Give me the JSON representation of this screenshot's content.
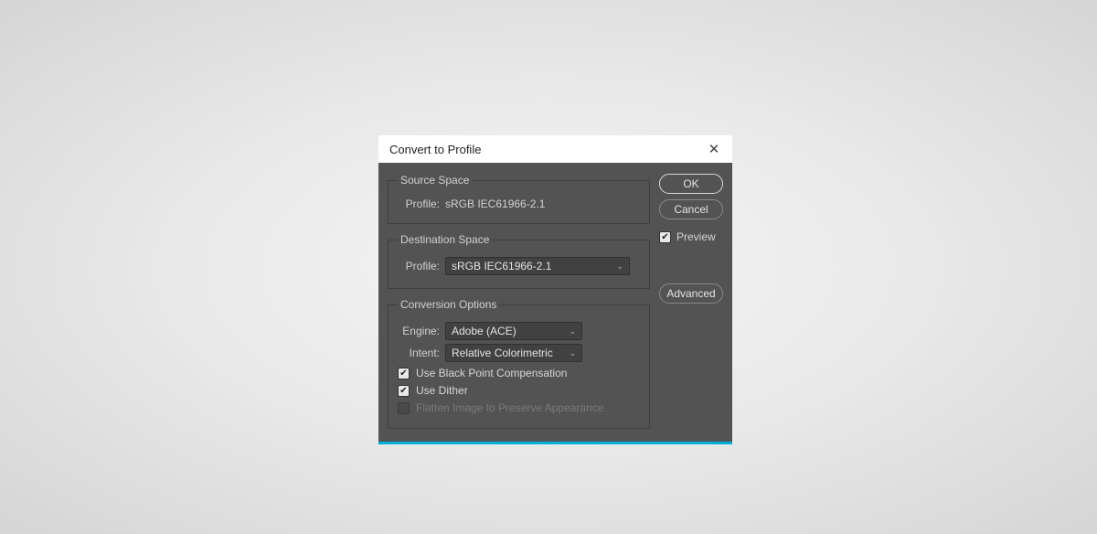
{
  "dialog": {
    "title": "Convert to Profile",
    "source_space": {
      "legend": "Source Space",
      "profile_label": "Profile:",
      "profile_value": "sRGB IEC61966-2.1"
    },
    "destination_space": {
      "legend": "Destination Space",
      "profile_label": "Profile:",
      "profile_value": "sRGB IEC61966-2.1"
    },
    "conversion_options": {
      "legend": "Conversion Options",
      "engine_label": "Engine:",
      "engine_value": "Adobe (ACE)",
      "intent_label": "Intent:",
      "intent_value": "Relative Colorimetric",
      "bpc_label": "Use Black Point Compensation",
      "dither_label": "Use Dither",
      "flatten_label": "Flatten Image to Preserve Appearance"
    },
    "buttons": {
      "ok": "OK",
      "cancel": "Cancel",
      "preview": "Preview",
      "advanced": "Advanced"
    }
  }
}
